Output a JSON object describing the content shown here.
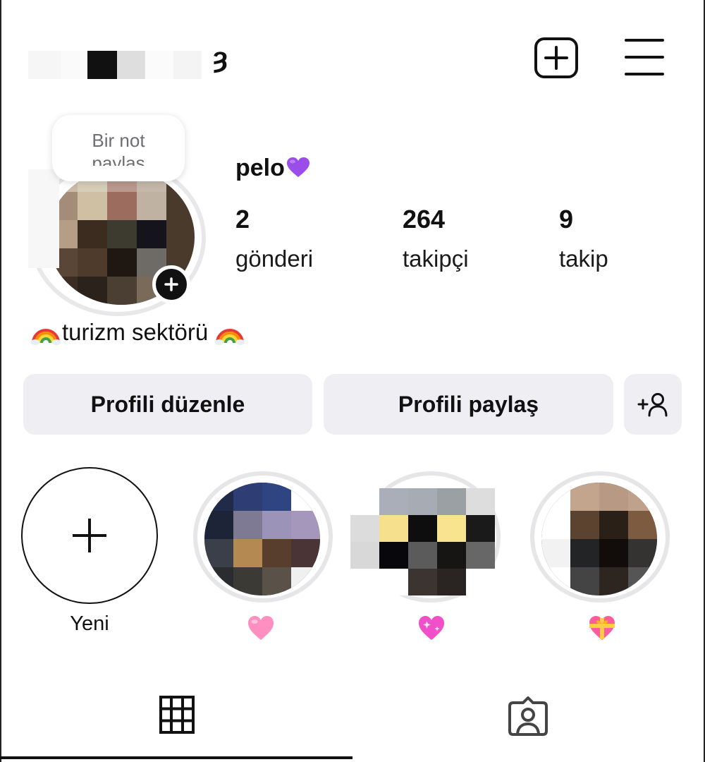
{
  "header": {
    "username_visible_fragment": "ȝ",
    "new_post_icon": "plus-square-icon",
    "menu_icon": "hamburger-menu-icon"
  },
  "note": {
    "line1": "Bir not",
    "line2": "paylaş"
  },
  "profile": {
    "display_name": "pelo",
    "name_emoji": "purple-heart",
    "stats": [
      {
        "value": "2",
        "label": "gönderi"
      },
      {
        "value": "264",
        "label": "takipçi"
      },
      {
        "value": "9",
        "label": "takip"
      }
    ],
    "bio": "turizm sektörü"
  },
  "buttons": {
    "edit_profile": "Profili düzenle",
    "share_profile": "Profili paylaş",
    "add_user_icon": "add-person-icon"
  },
  "highlights": {
    "new_label": "Yeni",
    "items": [
      {
        "emoji": "pink-heart"
      },
      {
        "emoji": "sparkling-heart"
      },
      {
        "emoji": "heart-with-ribbon"
      }
    ]
  },
  "tabs": [
    {
      "icon": "grid-icon",
      "active": true
    },
    {
      "icon": "tagged-person-icon",
      "active": false
    }
  ],
  "colors": {
    "button_bg": "#efeff3",
    "ring": "#e6e6e8",
    "text": "#111111"
  }
}
